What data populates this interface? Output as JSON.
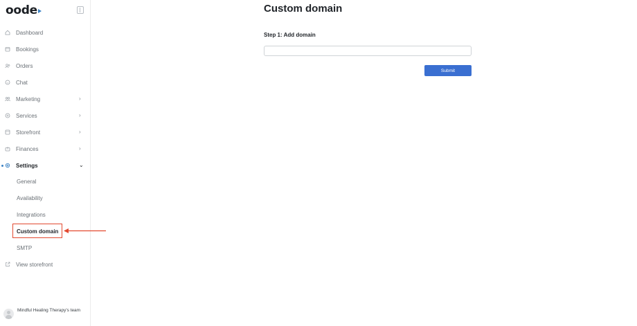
{
  "app": {
    "logo_text": "oode",
    "accent_color": "#3b82c4"
  },
  "sidebar": {
    "items": [
      {
        "label": "Dashboard",
        "icon": "home-icon"
      },
      {
        "label": "Bookings",
        "icon": "calendar-icon"
      },
      {
        "label": "Orders",
        "icon": "orders-icon"
      },
      {
        "label": "Chat",
        "icon": "chat-icon"
      },
      {
        "label": "Marketing",
        "icon": "megaphone-icon",
        "chevron": "›"
      },
      {
        "label": "Services",
        "icon": "services-icon",
        "chevron": "›"
      },
      {
        "label": "Storefront",
        "icon": "storefront-icon",
        "chevron": "›"
      },
      {
        "label": "Finances",
        "icon": "finances-icon",
        "chevron": "›"
      },
      {
        "label": "Settings",
        "icon": "gear-icon",
        "chevron": "⌄",
        "active": true
      }
    ],
    "settings_sub": [
      "General",
      "Availability",
      "Integrations",
      "Custom domain",
      "SMTP"
    ],
    "view_storefront": "View storefront",
    "team_name": "Mindful Healing Therapy's team"
  },
  "main": {
    "title": "Custom domain",
    "step_label": "Step 1: Add domain",
    "domain_value": "",
    "submit_label": "Submit",
    "submit_color": "#3a6fd1"
  },
  "annotation": {
    "highlight_color": "#e2492f"
  }
}
